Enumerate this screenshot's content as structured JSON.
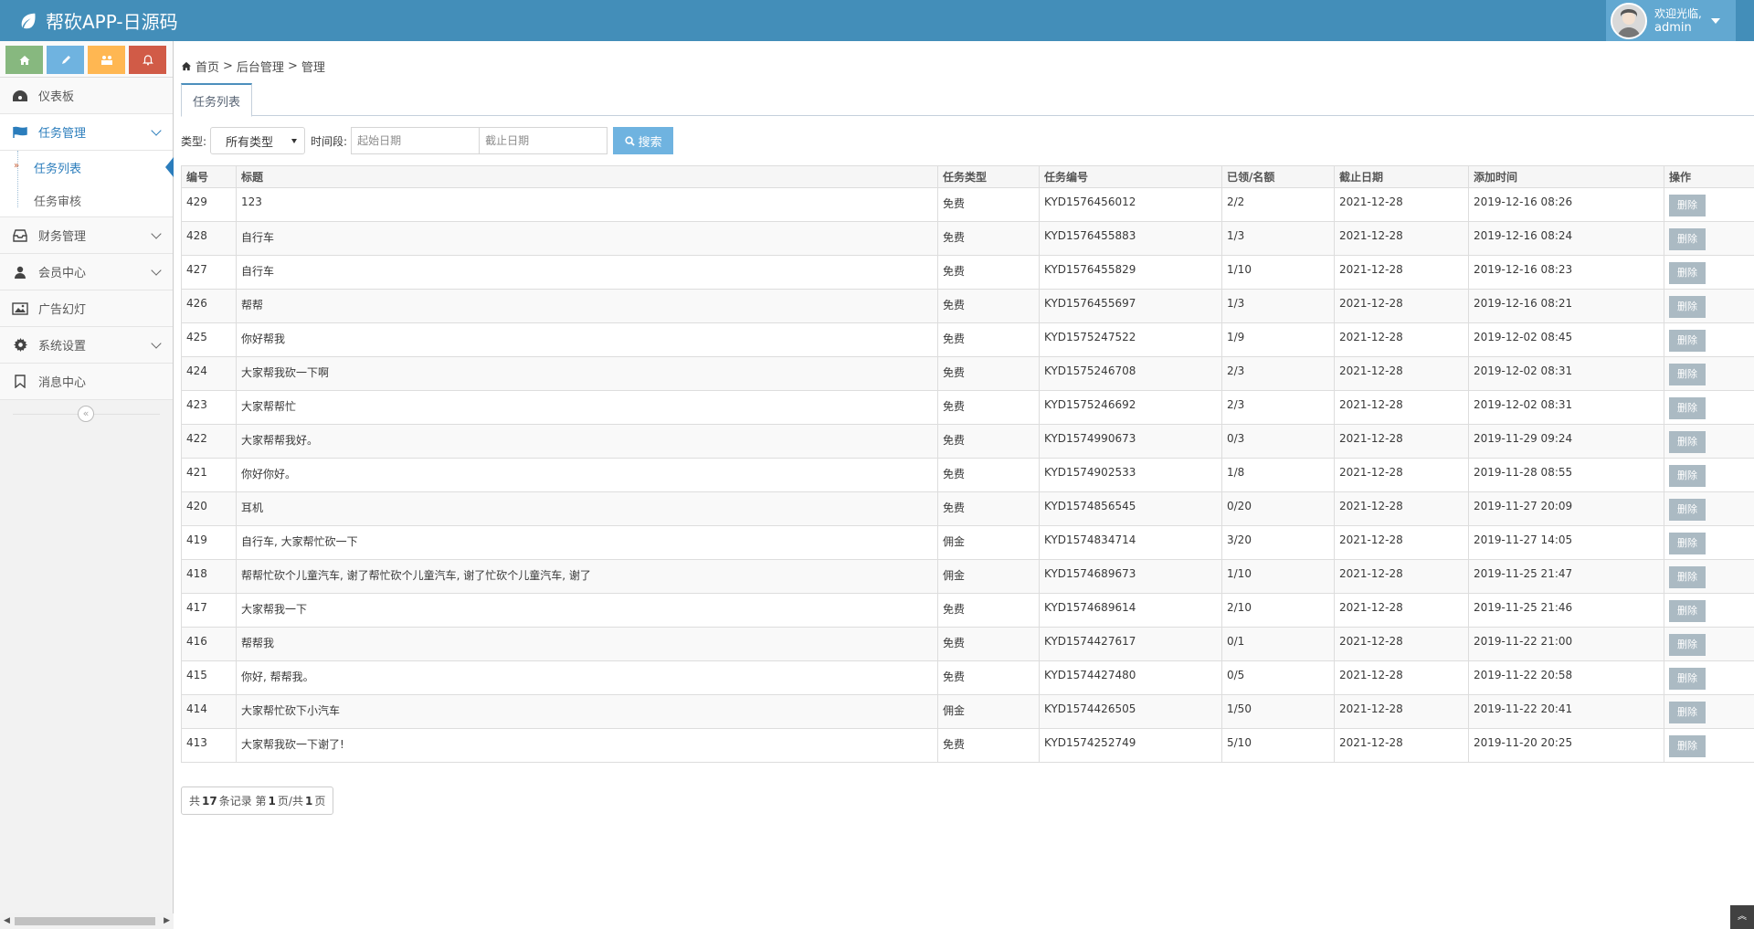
{
  "app": {
    "title": "帮砍APP-日源码"
  },
  "user": {
    "welcome": "欢迎光临,",
    "name": "admin"
  },
  "sidebar": {
    "items": [
      {
        "label": "仪表板"
      },
      {
        "label": "任务管理"
      },
      {
        "label": "财务管理"
      },
      {
        "label": "会员中心"
      },
      {
        "label": "广告幻灯"
      },
      {
        "label": "系统设置"
      },
      {
        "label": "消息中心"
      }
    ],
    "submenu": [
      {
        "label": "任务列表"
      },
      {
        "label": "任务审核"
      }
    ]
  },
  "breadcrumb": {
    "home": "首页",
    "sep1": ">",
    "section": "后台管理",
    "sep2": ">",
    "page": "管理"
  },
  "tabs": {
    "active": "任务列表"
  },
  "filter": {
    "type_label": "类型:",
    "type_value": "所有类型",
    "period_label": "时间段:",
    "start_placeholder": "起始日期",
    "end_placeholder": "截止日期",
    "search_label": "搜索"
  },
  "table": {
    "headers": [
      "编号",
      "标题",
      "任务类型",
      "任务编号",
      "已领/名额",
      "截止日期",
      "添加时间",
      "操作"
    ],
    "delete_label": "删除",
    "rows": [
      [
        "429",
        "123",
        "免费",
        "KYD1576456012",
        "2/2",
        "2021-12-28",
        "2019-12-16 08:26"
      ],
      [
        "428",
        "自行车",
        "免费",
        "KYD1576455883",
        "1/3",
        "2021-12-28",
        "2019-12-16 08:24"
      ],
      [
        "427",
        "自行车",
        "免费",
        "KYD1576455829",
        "1/10",
        "2021-12-28",
        "2019-12-16 08:23"
      ],
      [
        "426",
        "帮帮",
        "免费",
        "KYD1576455697",
        "1/3",
        "2021-12-28",
        "2019-12-16 08:21"
      ],
      [
        "425",
        "你好帮我",
        "免费",
        "KYD1575247522",
        "1/9",
        "2021-12-28",
        "2019-12-02 08:45"
      ],
      [
        "424",
        "大家帮我砍一下啊",
        "免费",
        "KYD1575246708",
        "2/3",
        "2021-12-28",
        "2019-12-02 08:31"
      ],
      [
        "423",
        "大家帮帮忙",
        "免费",
        "KYD1575246692",
        "2/3",
        "2021-12-28",
        "2019-12-02 08:31"
      ],
      [
        "422",
        "大家帮帮我好。",
        "免费",
        "KYD1574990673",
        "0/3",
        "2021-12-28",
        "2019-11-29 09:24"
      ],
      [
        "421",
        "你好你好。",
        "免费",
        "KYD1574902533",
        "1/8",
        "2021-12-28",
        "2019-11-28 08:55"
      ],
      [
        "420",
        "耳机",
        "免费",
        "KYD1574856545",
        "0/20",
        "2021-12-28",
        "2019-11-27 20:09"
      ],
      [
        "419",
        "自行车, 大家帮忙砍一下",
        "佣金",
        "KYD1574834714",
        "3/20",
        "2021-12-28",
        "2019-11-27 14:05"
      ],
      [
        "418",
        "帮帮忙砍个儿童汽车, 谢了帮忙砍个儿童汽车, 谢了忙砍个儿童汽车, 谢了",
        "佣金",
        "KYD1574689673",
        "1/10",
        "2021-12-28",
        "2019-11-25 21:47"
      ],
      [
        "417",
        "大家帮我一下",
        "免费",
        "KYD1574689614",
        "2/10",
        "2021-12-28",
        "2019-11-25 21:46"
      ],
      [
        "416",
        "帮帮我",
        "免费",
        "KYD1574427617",
        "0/1",
        "2021-12-28",
        "2019-11-22 21:00"
      ],
      [
        "415",
        "你好, 帮帮我。",
        "免费",
        "KYD1574427480",
        "0/5",
        "2021-12-28",
        "2019-11-22 20:58"
      ],
      [
        "414",
        "大家帮忙砍下小汽车",
        "佣金",
        "KYD1574426505",
        "1/50",
        "2021-12-28",
        "2019-11-22 20:41"
      ],
      [
        "413",
        "大家帮我砍一下谢了!",
        "免费",
        "KYD1574252749",
        "5/10",
        "2021-12-28",
        "2019-11-20 20:25"
      ]
    ]
  },
  "pager": {
    "prefix": "共",
    "total": "17",
    "mid": "条记录 第",
    "page": "1",
    "mid2": "页/共",
    "pages": "1",
    "suffix": "页"
  },
  "colors": {
    "navbar": "#438eb9",
    "accent": "#2b7dbc",
    "delete": "#abbac3",
    "search": "#6fb3e0"
  }
}
